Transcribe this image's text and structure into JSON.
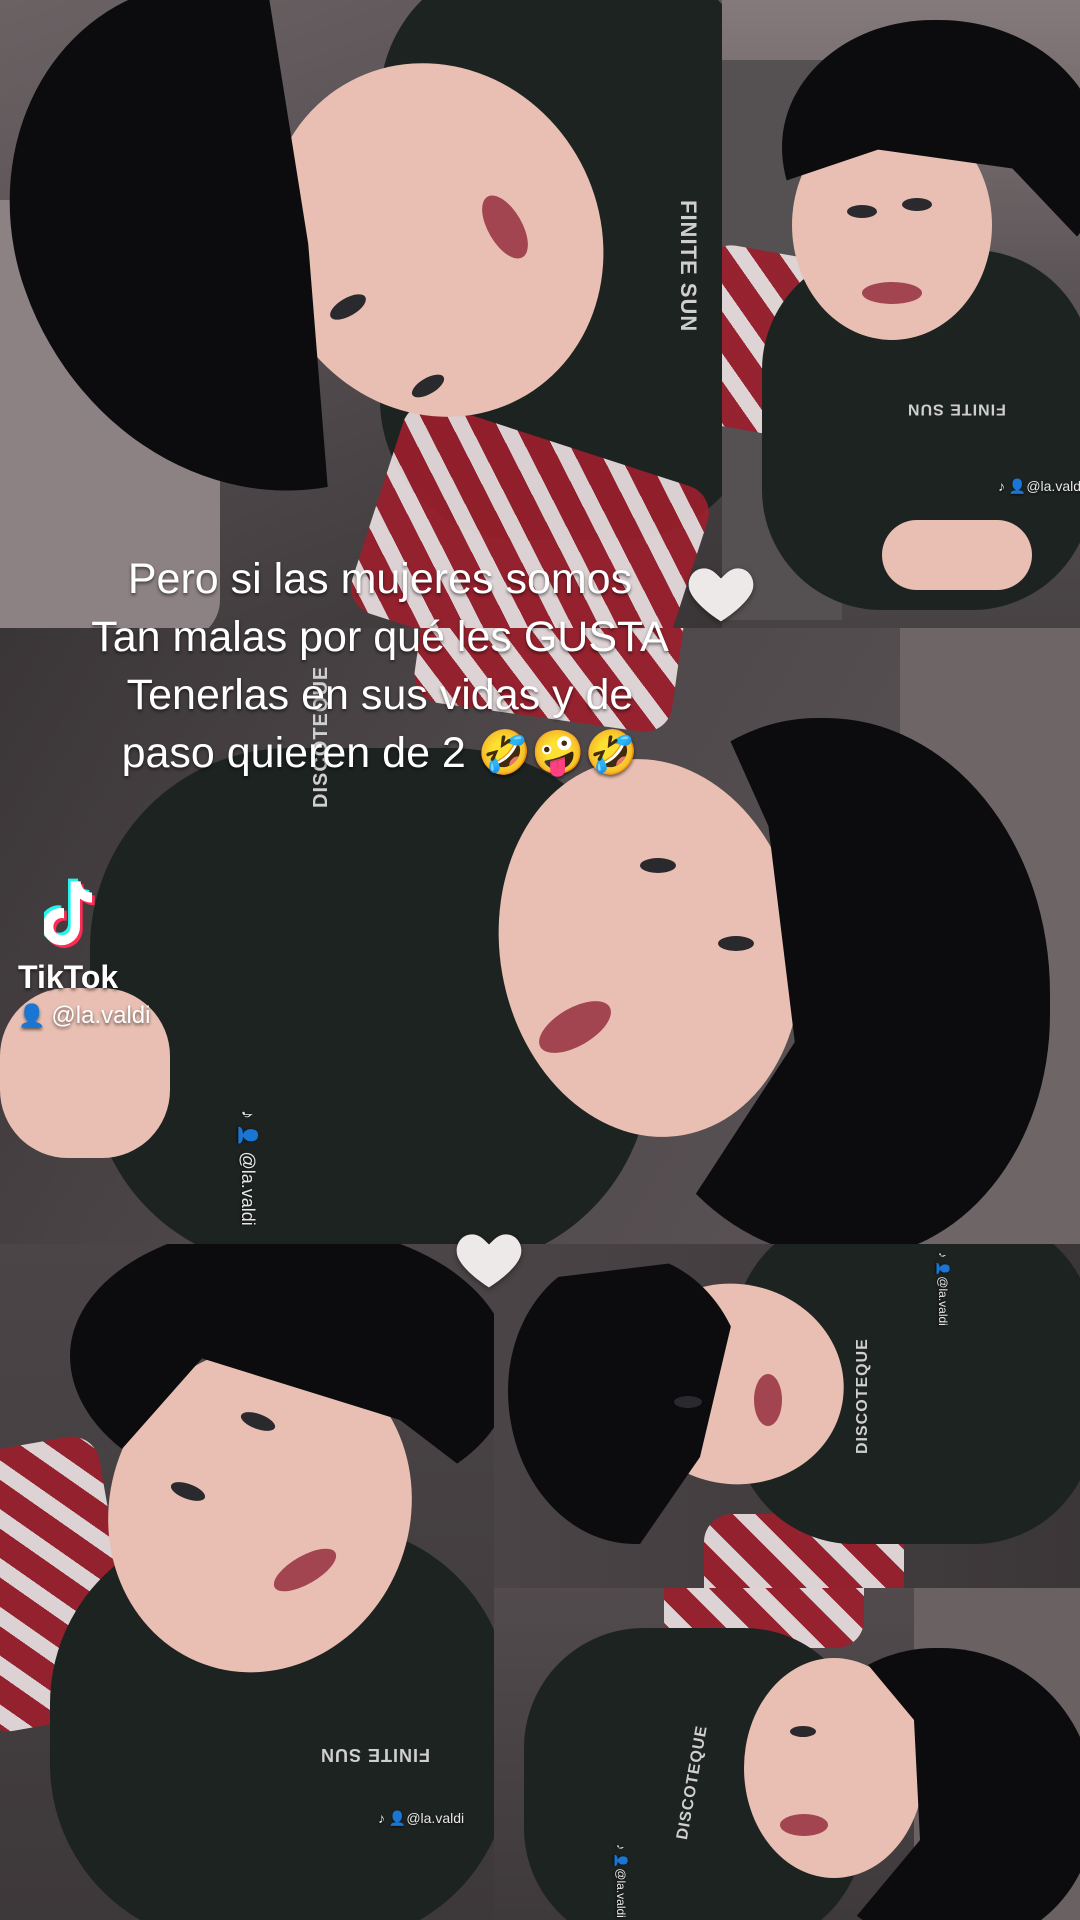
{
  "caption": {
    "line1": "Pero si las mujeres somos",
    "line2": "Tan malas por qué les GUSTA",
    "line3": "Tenerlas en sus vidas y de",
    "line4": "paso quieren de 2 🤣🤪🤣"
  },
  "hearts": [
    "white-heart-icon",
    "white-heart-icon"
  ],
  "tiktok": {
    "brand": "TikTok",
    "username": "@la.valdi"
  },
  "watermarks": {
    "p2": "@la.valdi",
    "p3": "@la.valdi",
    "p5": "@la.valdi",
    "p6": "@la.valdi",
    "p4": "@la.valdi"
  },
  "shirt_print": {
    "a": "FINITE SUN",
    "b": "DISCOTEQUE"
  },
  "colors": {
    "caption_text": "#ffffff",
    "hoodie": "#1d2321",
    "hair": "#0c0c0f",
    "cushion_red": "#9b1f2c"
  }
}
